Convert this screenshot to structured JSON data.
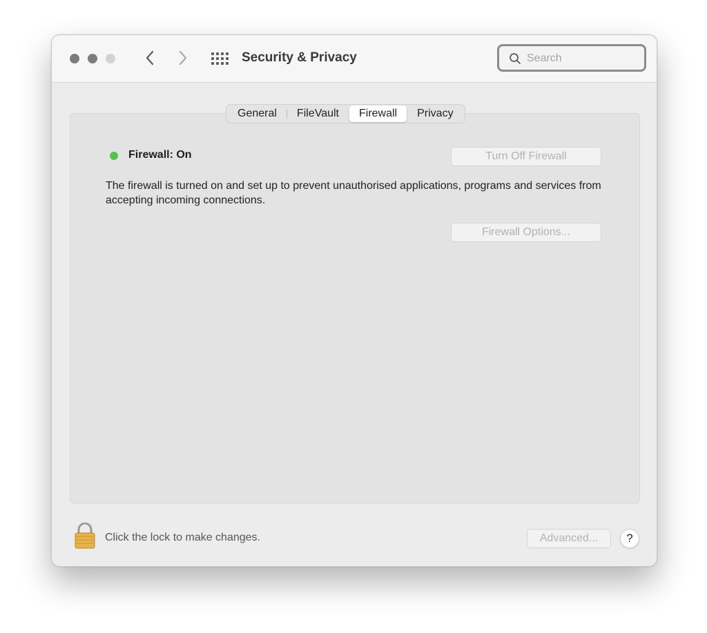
{
  "window": {
    "title": "Security & Privacy"
  },
  "toolbar": {
    "back_icon": "chevron-left-icon",
    "forward_icon": "chevron-right-icon",
    "grid_icon": "show-all-grid-icon"
  },
  "search": {
    "placeholder": "Search",
    "value": ""
  },
  "tabs": [
    {
      "label": "General",
      "active": false
    },
    {
      "label": "FileVault",
      "active": false
    },
    {
      "label": "Firewall",
      "active": true
    },
    {
      "label": "Privacy",
      "active": false
    }
  ],
  "firewall": {
    "status_label": "Firewall: On",
    "status_color": "#57c24e",
    "turn_off_button": "Turn Off Firewall",
    "description": "The firewall is turned on and set up to prevent unauthorised applications, programs and services from accepting incoming connections.",
    "options_button": "Firewall Options..."
  },
  "footer": {
    "lock_text": "Click the lock to make changes.",
    "advanced_button": "Advanced...",
    "help_label": "?"
  }
}
